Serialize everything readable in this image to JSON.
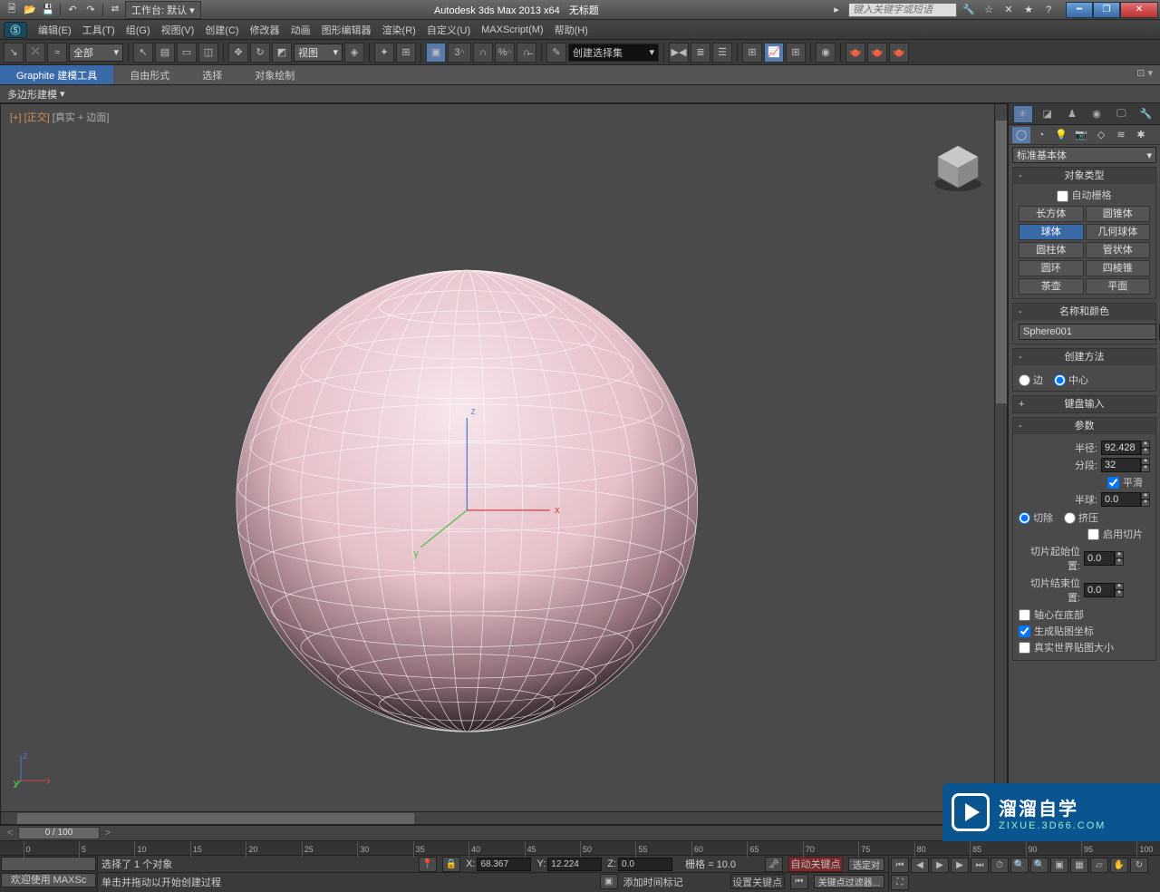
{
  "title": {
    "app": "Autodesk 3ds Max  2013 x64",
    "doc": "无标题",
    "workspace_label": "工作台: 默认",
    "search_placeholder": "键入关键字或短语"
  },
  "menu": [
    "编辑(E)",
    "工具(T)",
    "组(G)",
    "视图(V)",
    "创建(C)",
    "修改器",
    "动画",
    "图形编辑器",
    "渲染(R)",
    "自定义(U)",
    "MAXScript(M)",
    "帮助(H)"
  ],
  "toolbar": {
    "filter": "全部",
    "refcoord": "视图",
    "named_sel": "创建选择集"
  },
  "ribbon": {
    "tabs": [
      "Graphite 建模工具",
      "自由形式",
      "选择",
      "对象绘制"
    ],
    "sub": "多边形建模"
  },
  "viewport": {
    "label_bracket1": "[+]",
    "label_bracket2": "[正交]",
    "label_mode": "[真实 + 边面]"
  },
  "cmd": {
    "category": "标准基本体",
    "obj_header": "对象类型",
    "auto_grid": "自动栅格",
    "obj_types": [
      [
        "长方体",
        "圆锥体"
      ],
      [
        "球体",
        "几何球体"
      ],
      [
        "圆柱体",
        "管状体"
      ],
      [
        "圆环",
        "四棱锥"
      ],
      [
        "茶壶",
        "平面"
      ]
    ],
    "active_obj": "球体",
    "name_header": "名称和颜色",
    "name_value": "Sphere001",
    "create_header": "创建方法",
    "edge": "边",
    "center": "中心",
    "kbd_header": "键盘输入",
    "params_header": "参数",
    "radius_label": "半径:",
    "radius_value": "92.428",
    "segments_label": "分段:",
    "segments_value": "32",
    "smooth_label": "平滑",
    "hemi_label": "半球:",
    "hemi_value": "0.0",
    "chop": "切除",
    "squash": "挤压",
    "slice_on": "启用切片",
    "slice_from_label": "切片起始位置:",
    "slice_from_value": "0.0",
    "slice_to_label": "切片结束位置:",
    "slice_to_value": "0.0",
    "base_pivot": "轴心在底部",
    "gen_uv": "生成贴图坐标",
    "real_world": "真实世界贴图大小"
  },
  "status": {
    "frame": "0 / 100",
    "ticks": [
      0,
      5,
      10,
      15,
      20,
      25,
      30,
      35,
      40,
      45,
      50,
      55,
      60,
      65,
      70,
      75,
      80,
      85,
      90,
      95,
      100
    ],
    "welcome1": "欢迎使用",
    "welcome2": "MAXSc",
    "selection": "选择了 1 个对象",
    "prompt": "单击并拖动以开始创建过程",
    "x": "68.367",
    "y": "12.224",
    "z": "0.0",
    "grid": "栅格 = 10.0",
    "autokey": "自动关键点",
    "selected": "选定对",
    "setkey": "设置关键点",
    "keyfilter": "关键点过滤器...",
    "addtime": "添加时间标记"
  },
  "watermark": {
    "big": "溜溜自学",
    "small": "ZIXUE.3D66.COM"
  }
}
